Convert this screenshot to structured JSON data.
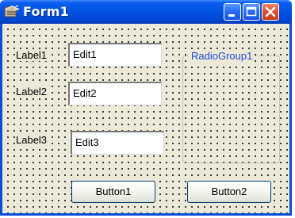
{
  "window": {
    "title": "Form1",
    "icons": {
      "app": "delphi-form-icon",
      "minimize": "minimize-icon",
      "maximize": "maximize-icon",
      "close": "close-icon"
    },
    "colors": {
      "titlebar": "#0052e0",
      "client": "#ece9d8",
      "radiogroup_caption": "#1a4fd8"
    }
  },
  "form": {
    "labels": [
      "Label1",
      "Label2",
      "Label3"
    ],
    "edits": [
      "Edit1",
      "Edit2",
      "Edit3"
    ],
    "radiogroup": {
      "caption": "RadioGroup1"
    },
    "buttons": [
      "Button1",
      "Button2"
    ]
  }
}
